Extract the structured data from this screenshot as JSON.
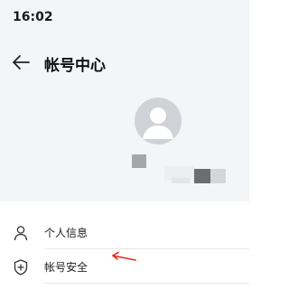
{
  "status_bar": {
    "time": "16:02"
  },
  "nav": {
    "back_icon": "arrow-left-icon",
    "title": "帐号中心"
  },
  "profile": {
    "avatar_icon": "user-avatar-icon"
  },
  "menu": [
    {
      "label": "个人信息",
      "icon": "user-outline-icon"
    },
    {
      "label": "帐号安全",
      "icon": "shield-plus-icon"
    }
  ],
  "colors": {
    "header_bg": "#f3f5f7",
    "annotation_arrow": "#e0301e"
  }
}
